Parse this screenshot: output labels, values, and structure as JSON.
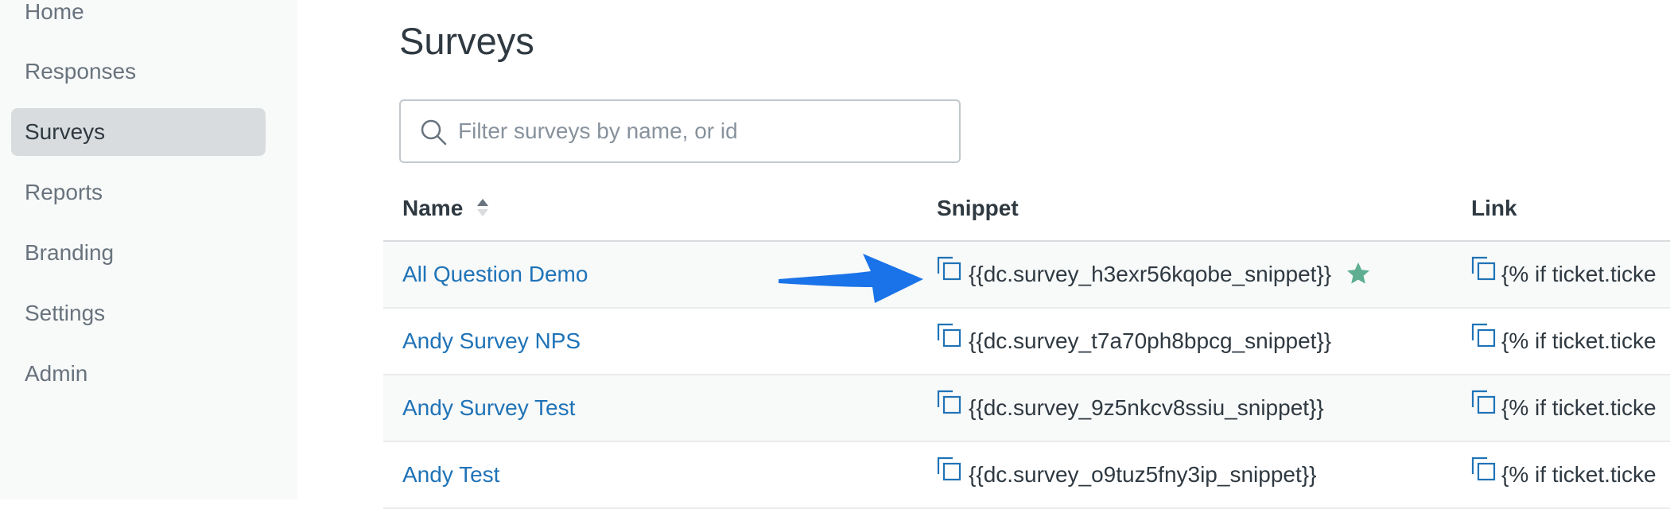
{
  "sidebar": {
    "items": [
      {
        "label": "Home",
        "active": false
      },
      {
        "label": "Responses",
        "active": false
      },
      {
        "label": "Surveys",
        "active": true
      },
      {
        "label": "Reports",
        "active": false
      },
      {
        "label": "Branding",
        "active": false
      },
      {
        "label": "Settings",
        "active": false
      },
      {
        "label": "Admin",
        "active": false
      }
    ]
  },
  "page": {
    "title": "Surveys"
  },
  "search": {
    "placeholder": "Filter surveys by name, or id",
    "value": "",
    "icon": "search-icon"
  },
  "table": {
    "columns": [
      "Name",
      "Snippet",
      "Link"
    ],
    "sort_column": "Name",
    "rows": [
      {
        "name": "All Question Demo",
        "snippet": "{{dc.survey_h3exr56kqobe_snippet}}",
        "starred": true,
        "link": "{% if ticket.ticke"
      },
      {
        "name": "Andy Survey NPS",
        "snippet": "{{dc.survey_t7a70ph8bpcg_snippet}}",
        "starred": false,
        "link": "{% if ticket.ticke"
      },
      {
        "name": "Andy Survey Test",
        "snippet": "{{dc.survey_9z5nkcv8ssiu_snippet}}",
        "starred": false,
        "link": "{% if ticket.ticke"
      },
      {
        "name": "Andy Test",
        "snippet": "{{dc.survey_o9tuz5fny3ip_snippet}}",
        "starred": false,
        "link": "{% if ticket.ticke"
      }
    ]
  },
  "colors": {
    "link": "#1f73b7",
    "star": "#5eae91",
    "arrow": "#1a73e8",
    "active_nav": "#d8dcde"
  }
}
